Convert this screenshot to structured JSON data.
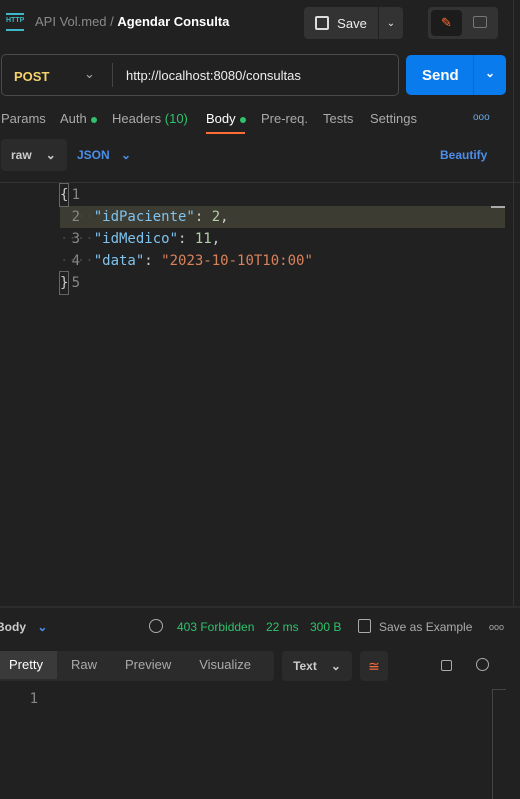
{
  "header": {
    "collection": "API Vol.med",
    "separator": "/",
    "request_name": "Agendar Consulta",
    "save_label": "Save"
  },
  "request": {
    "method": "POST",
    "url": "http://localhost:8080/consultas",
    "send_label": "Send"
  },
  "tabs": [
    {
      "label": "Params"
    },
    {
      "label": "Auth"
    },
    {
      "label": "Headers",
      "count": "(10)"
    },
    {
      "label": "Body",
      "active": true
    },
    {
      "label": "Pre-req."
    },
    {
      "label": "Tests"
    },
    {
      "label": "Settings"
    }
  ],
  "body_options": {
    "mode": "raw",
    "language": "JSON",
    "beautify": "Beautify"
  },
  "editor": {
    "line_numbers": [
      "1",
      "2",
      "3",
      "4",
      "5"
    ],
    "lines": {
      "l1": "{",
      "l2_key": "\"idPaciente\"",
      "l2_val": "2",
      "l3_key": "\"idMedico\"",
      "l3_val": "11",
      "l4_key": "\"data\"",
      "l4_val": "\"2023-10-10T10:00\"",
      "l5": "}"
    }
  },
  "response": {
    "label": "Body",
    "status": "403 Forbidden",
    "time": "22 ms",
    "size": "300 B",
    "save_example": "Save as Example",
    "tabs": [
      "Pretty",
      "Raw",
      "Preview",
      "Visualize"
    ],
    "format": "Text",
    "line_numbers": [
      "1"
    ]
  },
  "colors": {
    "accent": "#097bed",
    "status": "#2ec26b",
    "active_tab": "#ff6c37"
  }
}
